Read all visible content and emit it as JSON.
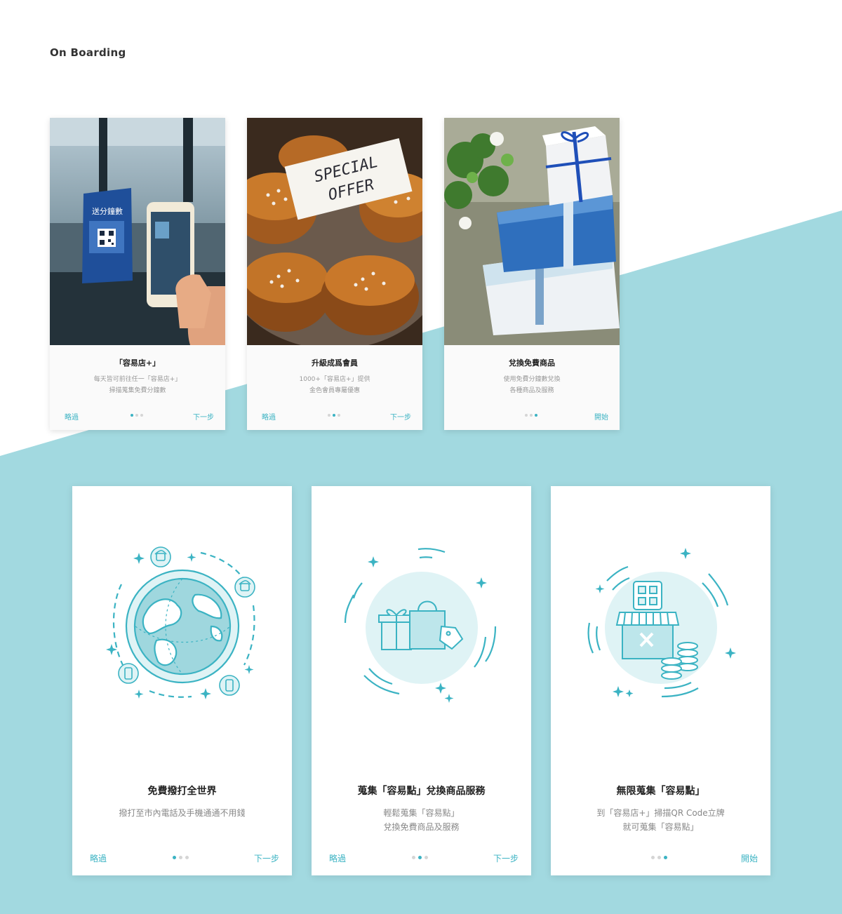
{
  "page": {
    "section_title": "On Boarding"
  },
  "colors": {
    "accent": "#3bb3c3",
    "teal_bg": "#a2d9e0",
    "illustration_fill": "#dff3f5",
    "illustration_stroke": "#3bb3c3"
  },
  "photo_cards": [
    {
      "image": "phone-scanning-qr-standee-photo",
      "standee_text": "送分鐘數",
      "title": "「容易店+」",
      "desc": [
        "每天皆可前往任一「容易店+」",
        "掃描蒐集免費分鐘數"
      ],
      "skip": "略過",
      "next": "下一步",
      "active_step": 1
    },
    {
      "image": "muffins-special-offer-photo",
      "sign_text": [
        "SPECIAL",
        "OFFER"
      ],
      "title": "升級成爲會員",
      "desc": [
        "1000+「容易店+」提供",
        "金色會員專屬優惠"
      ],
      "skip": "略過",
      "next": "下一步",
      "active_step": 2
    },
    {
      "image": "blue-gift-boxes-photo",
      "title": "兌換免費商品",
      "desc": [
        "使用免費分鐘數兌換",
        "各種商品及服務"
      ],
      "skip": "",
      "next": "開始",
      "active_step": 3
    }
  ],
  "illustrated_cards": [
    {
      "illustration": "globe-with-phones-icon",
      "title": "免費撥打全世界",
      "desc": [
        "撥打至市內電話及手機通通不用錢"
      ],
      "skip": "略過",
      "next": "下一步",
      "active_step": 1
    },
    {
      "illustration": "shopping-bag-gift-icon",
      "title": "蒐集「容易點」兌換商品服務",
      "desc": [
        "輕鬆蒐集「容易點」",
        "兌換免費商品及服務"
      ],
      "skip": "略過",
      "next": "下一步",
      "active_step": 2
    },
    {
      "illustration": "store-qr-coins-icon",
      "title": "無限蒐集「容易點」",
      "desc": [
        "到「容易店+」掃描QR Code立牌",
        "就可蒐集「容易點」"
      ],
      "skip": "",
      "next": "開始",
      "active_step": 3
    }
  ]
}
